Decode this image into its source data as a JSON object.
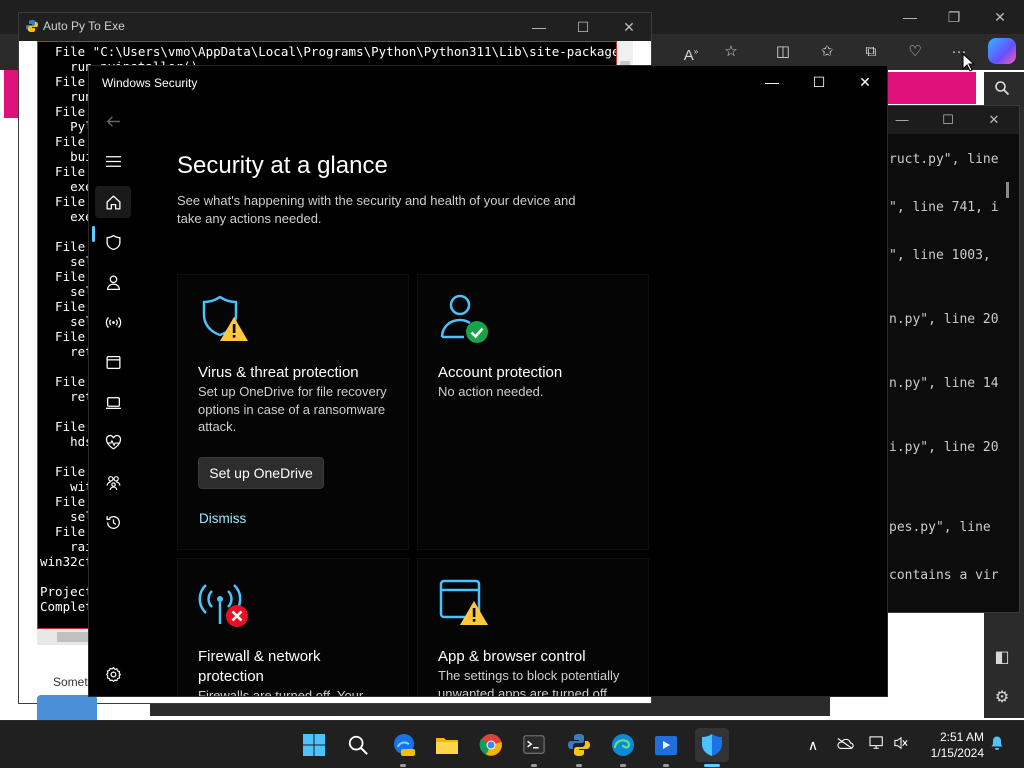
{
  "edge": {
    "caption_minimize": "—",
    "caption_restore": "❐",
    "caption_close": "✕",
    "more_label": "···"
  },
  "terminal_right": {
    "lines": [
      "ruct.py\", line",
      "\", line 741, i",
      "\", line 1003,",
      "n.py\", line 20",
      "n.py\", line 14",
      "i.py\", line 20",
      "pes.py\", line",
      "contains a vir"
    ]
  },
  "auto_py_to_exe": {
    "title": "Auto Py To Exe",
    "console_lines": [
      "  File \"C:\\Users\\vmo\\AppData\\Local\\Programs\\Python\\Python311\\Lib\\site-packages\\",
      "    run_pyinstaller()",
      "  File",
      "    run",
      "  File",
      "    Pyl",
      "  File",
      "    bui",
      "  File",
      "    exe",
      "  File",
      "    exe",
      "",
      "  File",
      "    sel",
      "  File",
      "    sel",
      "  File",
      "    sel",
      "  File",
      "    ret",
      "",
      "  File",
      "    ret",
      "",
      "  File",
      "    hds",
      "",
      "  File",
      "    wit",
      "  File",
      "    sel",
      "  File",
      "    rai",
      "win32ct",
      "",
      "Project",
      "Complet"
    ],
    "status_text": "Somet"
  },
  "windows_security": {
    "title": "Windows Security",
    "minimize": "—",
    "maximize": "☐",
    "close": "✕",
    "heading": "Security at a glance",
    "subtitle": "See what's happening with the security and health of your device and take any actions needed.",
    "cards": {
      "virus": {
        "title": "Virus & threat protection",
        "text": "Set up OneDrive for file recovery options in case of a ransomware attack.",
        "button": "Set up OneDrive",
        "link": "Dismiss"
      },
      "account": {
        "title": "Account protection",
        "text": "No action needed."
      },
      "firewall": {
        "title": "Firewall & network protection",
        "text": "Firewalls are turned off. Your"
      },
      "app_browser": {
        "title": "App & browser control",
        "text": "The settings to block potentially unwanted apps are turned off."
      }
    },
    "status_colors": {
      "warning": "#ffc83d",
      "ok": "#16a34a",
      "error": "#e81123",
      "accent": "#0078d4"
    }
  },
  "taskbar": {
    "time": "2:51 AM",
    "date": "1/15/2024"
  }
}
